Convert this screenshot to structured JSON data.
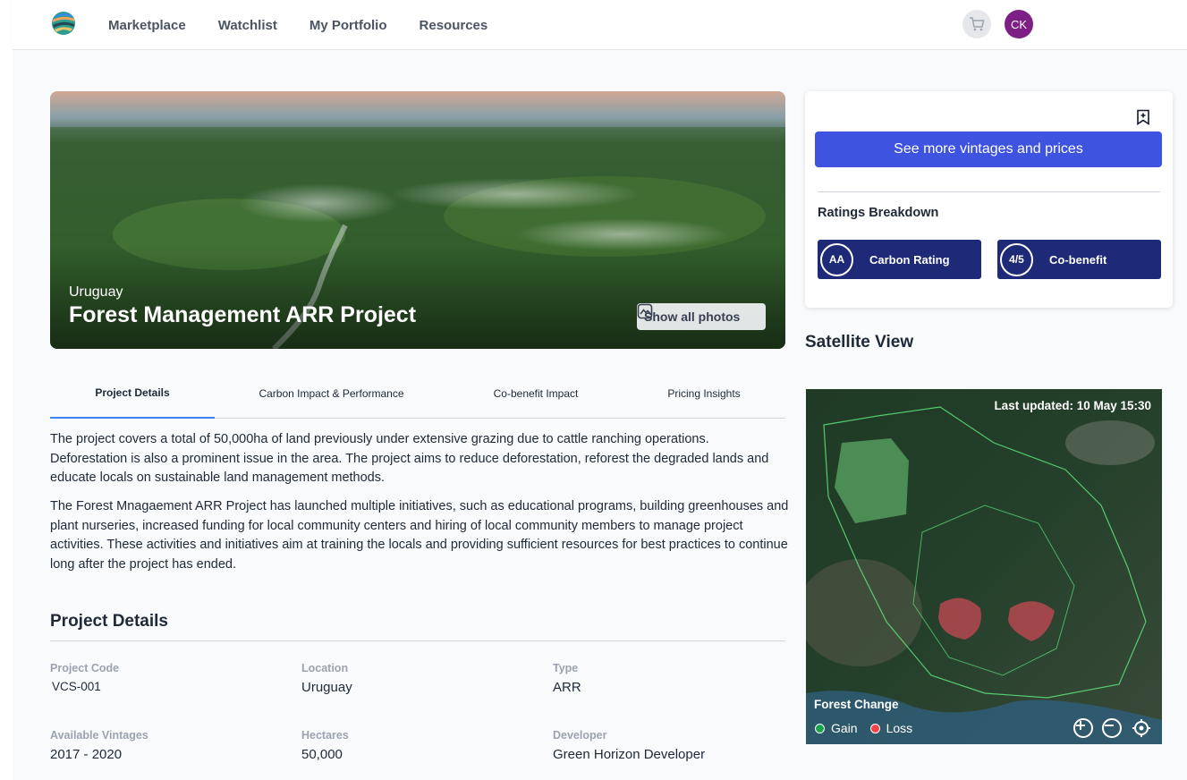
{
  "nav": {
    "links": [
      "Marketplace",
      "Watchlist",
      "My Portfolio",
      "Resources"
    ],
    "avatar_initials": "CK",
    "logo_icon": "globe-logo",
    "cart_icon": "cart-icon"
  },
  "hero": {
    "country": "Uruguay",
    "title": "Forest Management ARR Project",
    "photos_label": "Show all photos"
  },
  "tabs": [
    "Project Details",
    "Carbon Impact & Performance",
    "Co-benefit Impact",
    "Pricing Insights"
  ],
  "description": [
    "The project covers a total of 50,000ha of land previously under extensive grazing due to cattle ranching operations. Deforestation is also a prominent issue in the area. The project aims to reduce deforestation, reforest the degraded lands and educate locals on sustainable land management methods.",
    "The Forest Mnagaement ARR Project has launched multiple initiatives, such as educational programs, building greenhouses and plant nurseries, increased funding for local community centers and hiring of local community members to manage project activities. These activities and initiatives aim at training the locals and providing sufficient resources for best practices to continue long after the project has ended."
  ],
  "details": {
    "title": "Project Details",
    "items": [
      {
        "label": "Project Code",
        "value": "VCS-001"
      },
      {
        "label": "Location",
        "value": "Uruguay"
      },
      {
        "label": "Type",
        "value": "ARR"
      },
      {
        "label": "Available Vintages",
        "value": "2017 - 2020"
      },
      {
        "label": "Hectares",
        "value": "50,000"
      },
      {
        "label": "Developer",
        "value": "Green Horizon Developer"
      }
    ]
  },
  "card": {
    "vintages_button": "See more vintages and prices",
    "ratings_title": "Ratings Breakdown",
    "ratings": [
      {
        "badge": "AA",
        "label": "Carbon Rating"
      },
      {
        "badge": "4/5",
        "label": "Co-benefit"
      }
    ]
  },
  "satellite": {
    "title": "Satellite View",
    "updated": "Last updated: 10 May 15:30",
    "legend_title": "Forest Change",
    "legend": [
      {
        "label": "Gain",
        "color": "#16a34a"
      },
      {
        "label": "Loss",
        "color": "#ef4444"
      }
    ]
  },
  "colors": {
    "primary": "#3e54e0",
    "rating_bg": "#1e2a78",
    "avatar": "#7e1f86",
    "tab_active": "#3b82f6"
  }
}
